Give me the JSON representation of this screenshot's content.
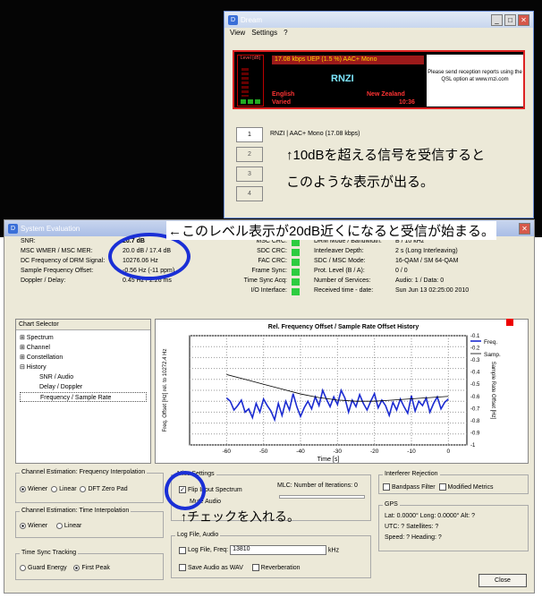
{
  "app": {
    "title": "Dream",
    "menu": [
      "View",
      "Settings",
      "?"
    ]
  },
  "display": {
    "level_label": "Level [dB]",
    "bitrate": "17.08 kbps UEP (1.5 %) AAC+ Mono",
    "service_name": "RNZI",
    "language": "English",
    "country": "New Zealand",
    "program_type": "Varied",
    "time": "10:36",
    "qsl_text": "Please send reception reports using the QSL option at www.rnzi.com"
  },
  "services": {
    "buttons": [
      "1",
      "2",
      "3",
      "4"
    ],
    "label": "RNZI  |  AAC+ Mono (17.08 kbps)"
  },
  "annotations": {
    "a1": "↑10dBを超える信号を受信すると",
    "a2": "このような表示が出る。",
    "a_top": "←このレベル表示が20dB近くになると受信が始まる。",
    "a3": "↑チェックを入れる。"
  },
  "eval": {
    "title": "System Evaluation",
    "stats": [
      {
        "k": "SNR:",
        "v": "20.7 dB"
      },
      {
        "k": "MSC WMER / MSC MER:",
        "v": "20.0 dB / 17.4 dB"
      },
      {
        "k": "DC Frequency of DRM Signal:",
        "v": "10276.06 Hz"
      },
      {
        "k": "Sample Frequency Offset:",
        "v": "-0.56 Hz (-11 ppm)"
      },
      {
        "k": "Doppler / Delay:",
        "v": "0.45 Hz / 2.26 ms"
      }
    ],
    "crcs": [
      "MSC CRC:",
      "SDC CRC:",
      "FAC CRC:",
      "Frame Sync:",
      "Time Sync Acq:",
      "I/O Interface:"
    ],
    "drm": [
      {
        "k": "DRM Mode / Bandwidth:",
        "v": "B / 10 kHz"
      },
      {
        "k": "Interleaver Depth:",
        "v": "2 s (Long Interleaving)"
      },
      {
        "k": "SDC / MSC Mode:",
        "v": "16-QAM / SM 64-QAM"
      },
      {
        "k": "Prot. Level (B / A):",
        "v": "0 / 0"
      },
      {
        "k": "Number of Services:",
        "v": "Audio: 1 / Data: 0"
      },
      {
        "k": "Received time - date:",
        "v": "Sun Jun 13 02:25:00 2010"
      }
    ]
  },
  "chart_selector": {
    "header": "Chart Selector",
    "items": [
      {
        "label": "Spectrum",
        "indent": 0,
        "prefix": "⊞ "
      },
      {
        "label": "Channel",
        "indent": 0,
        "prefix": "⊞ "
      },
      {
        "label": "Constellation",
        "indent": 0,
        "prefix": "⊞ "
      },
      {
        "label": "History",
        "indent": 0,
        "prefix": "⊟ "
      },
      {
        "label": "SNR / Audio",
        "indent": 1,
        "prefix": ""
      },
      {
        "label": "Delay / Doppler",
        "indent": 1,
        "prefix": ""
      },
      {
        "label": "Frequency / Sample Rate",
        "indent": 1,
        "prefix": ""
      }
    ]
  },
  "chart_data": {
    "type": "line",
    "title": "Rel. Frequency Offset / Sample Rate Offset History",
    "xlabel": "Time [s]",
    "ylabel": "Freq. Offset [Hz] rel. to 10272.4 Hz",
    "y2label": "Sample Rate Offset [Hz]",
    "xlim": [
      -70,
      5
    ],
    "ylim": [
      0,
      10
    ],
    "y2lim": [
      -1.0,
      -0.1
    ],
    "xticks": [
      "-60",
      "-50",
      "-40",
      "-30",
      "-20",
      "-10",
      "0"
    ],
    "yticks": [
      "0",
      "1",
      "2",
      "3",
      "4",
      "5",
      "6",
      "7",
      "8",
      "9",
      "10"
    ],
    "y2ticks": [
      "-0.1",
      "-0.2",
      "-0.3",
      "-0.4",
      "-0.5",
      "-0.6",
      "-0.7",
      "-0.8",
      "-0.9",
      "-1"
    ],
    "series": [
      {
        "name": "Freq.",
        "color": "#1b2bd1",
        "x": [
          -60,
          -59,
          -58,
          -57,
          -56,
          -55,
          -54,
          -53,
          -52,
          -51,
          -50,
          -49,
          -48,
          -47,
          -46,
          -45,
          -44,
          -43,
          -42,
          -41,
          -40,
          -39,
          -38,
          -37,
          -36,
          -35,
          -34,
          -33,
          -32,
          -31,
          -30,
          -29,
          -28,
          -27,
          -26,
          -25,
          -24,
          -23,
          -22,
          -21,
          -20,
          -19,
          -18,
          -17,
          -16,
          -15,
          -14,
          -13,
          -12,
          -11,
          -10,
          -9,
          -8,
          -7,
          -6,
          -5,
          -4,
          -3,
          -2,
          -1,
          0
        ],
        "y": [
          4.3,
          4.0,
          3.2,
          3.6,
          4.1,
          3.0,
          3.3,
          2.5,
          3.8,
          3.0,
          4.2,
          3.6,
          3.1,
          2.3,
          3.8,
          2.7,
          4.0,
          3.2,
          4.7,
          3.5,
          2.6,
          3.4,
          4.0,
          3.3,
          4.4,
          3.6,
          5.0,
          4.2,
          3.5,
          4.4,
          3.7,
          5.0,
          4.3,
          3.0,
          4.1,
          3.5,
          4.6,
          3.8,
          3.2,
          4.0,
          4.7,
          3.4,
          4.1,
          3.6,
          2.7,
          3.9,
          3.2,
          4.2,
          3.5,
          2.9,
          4.5,
          3.1,
          4.0,
          3.6,
          4.3,
          3.0,
          3.8,
          4.4,
          3.3,
          3.9,
          4.2
        ]
      },
      {
        "name": "Samp.",
        "color": "#000000",
        "x": [
          -60,
          -55,
          -50,
          -45,
          -40,
          -35,
          -30,
          -25,
          -20,
          -15,
          -10,
          -5,
          0
        ],
        "y": [
          -0.42,
          -0.46,
          -0.5,
          -0.54,
          -0.58,
          -0.61,
          -0.63,
          -0.64,
          -0.64,
          -0.63,
          -0.62,
          -0.61,
          -0.6
        ]
      }
    ],
    "legend_position": "top-right",
    "grid": true
  },
  "channel_freq": {
    "title": "Channel Estimation: Frequency Interpolation",
    "options": [
      "Wiener",
      "Linear",
      "DFT Zero Pad"
    ],
    "selected": 0
  },
  "channel_time": {
    "title": "Channel Estimation: Time Interpolation",
    "options": [
      "Wiener",
      "Linear"
    ],
    "selected": 0
  },
  "time_sync": {
    "title": "Time Sync Tracking",
    "options": [
      "Guard Energy",
      "First Peak"
    ],
    "selected": 1
  },
  "misc": {
    "title": "Misc Settings",
    "flip_label": "Flip Input Spectrum",
    "mute_label": "Mute Audio",
    "mlc_label": "MLC: Number of Iterations: 0"
  },
  "log": {
    "title": "Log File, Audio",
    "log_label": "Log File, Freq:",
    "freq_value": "13810",
    "unit": "kHz",
    "save_label": "Save Audio as WAV",
    "reverb_label": "Reverberation"
  },
  "interferer": {
    "title": "Interferer Rejection",
    "bandpass": "Bandpass Filter",
    "modified": "Modified Metrics"
  },
  "gps": {
    "title": "GPS",
    "line1": "Lat: 0.0000°   Long: 0.0000°   Alt: ?",
    "line2": "UTC: ?  Satellites: ?",
    "line3": "Speed: ?   Heading: ?"
  },
  "close_label": "Close"
}
